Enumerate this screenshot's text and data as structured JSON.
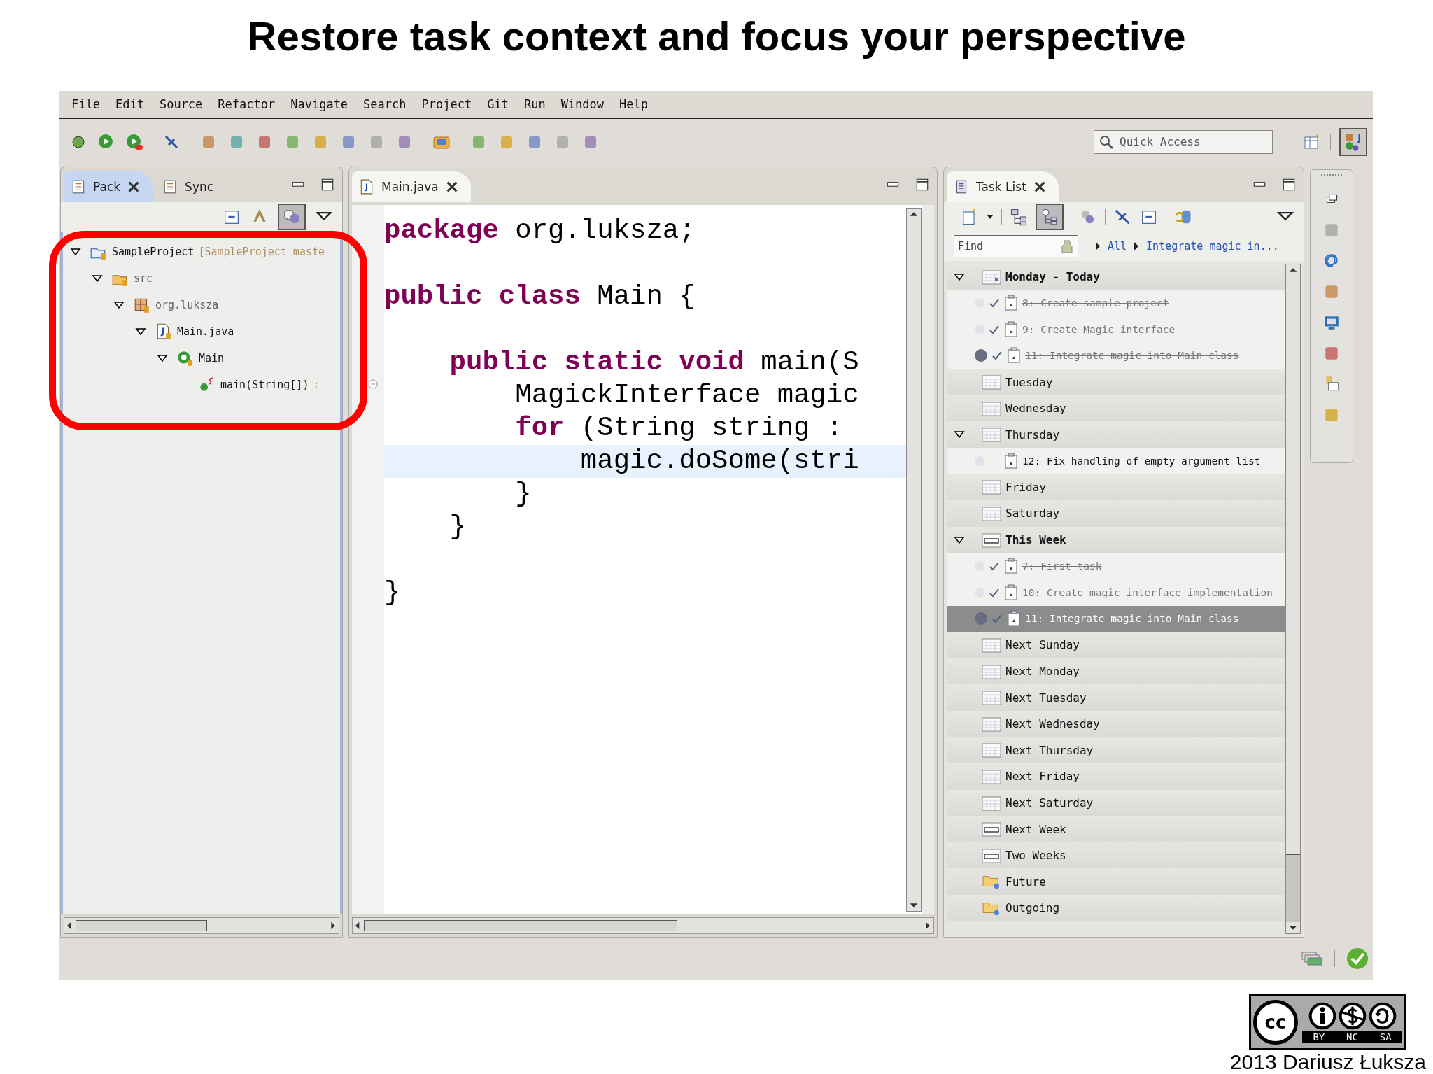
{
  "slide": {
    "title": "Restore task context and focus your perspective",
    "author": "2013 Dariusz Łuksza",
    "license_badge": {
      "mark": "cc",
      "labels": [
        "BY",
        "NC",
        "SA"
      ]
    }
  },
  "menu": [
    "File",
    "Edit",
    "Source",
    "Refactor",
    "Navigate",
    "Search",
    "Project",
    "Git",
    "Run",
    "Window",
    "Help"
  ],
  "quick_access": {
    "placeholder": "Quick Access"
  },
  "left_view": {
    "tabs": [
      {
        "label": "Pack",
        "selected": true
      },
      {
        "label": "Sync",
        "selected": false
      }
    ],
    "tree": [
      {
        "label": "SampleProject",
        "decoration": "[SampleProject maste",
        "kind": "project",
        "expanded": true,
        "children": [
          {
            "label": "src",
            "kind": "source-folder",
            "expanded": true,
            "children": [
              {
                "label": "org.luksza",
                "kind": "package",
                "expanded": true,
                "children": [
                  {
                    "label": "Main.java",
                    "kind": "file",
                    "expanded": true,
                    "children": [
                      {
                        "label": "Main",
                        "kind": "class",
                        "expanded": true,
                        "children": [
                          {
                            "label": "main(String[])",
                            "decoration": ":",
                            "kind": "method"
                          }
                        ]
                      }
                    ]
                  }
                ]
              }
            ]
          }
        ]
      }
    ]
  },
  "editor": {
    "tab": "Main.java",
    "lines": [
      {
        "kind": "code",
        "highlighted": false,
        "tokens": [
          {
            "text": "package",
            "keyword": true
          },
          {
            "text": " org.luksza;",
            "keyword": false
          }
        ]
      },
      {
        "kind": "blank"
      },
      {
        "kind": "code",
        "highlighted": false,
        "tokens": [
          {
            "text": "public class",
            "keyword": true
          },
          {
            "text": " Main {",
            "keyword": false
          }
        ]
      },
      {
        "kind": "blank"
      },
      {
        "kind": "code",
        "highlighted": false,
        "tokens": [
          {
            "text": "    public static void",
            "keyword": true
          },
          {
            "text": " main(S",
            "keyword": false
          }
        ]
      },
      {
        "kind": "code",
        "highlighted": false,
        "tokens": [
          {
            "text": "        MagickInterface magic",
            "keyword": false
          }
        ]
      },
      {
        "kind": "code",
        "highlighted": false,
        "tokens": [
          {
            "text": "        for",
            "keyword": true
          },
          {
            "text": " (String string :",
            "keyword": false
          }
        ]
      },
      {
        "kind": "code",
        "highlighted": true,
        "tokens": [
          {
            "text": "            magic.doSome(stri",
            "keyword": false
          }
        ]
      },
      {
        "kind": "code",
        "highlighted": false,
        "tokens": [
          {
            "text": "        }",
            "keyword": false
          }
        ]
      },
      {
        "kind": "code",
        "highlighted": false,
        "tokens": [
          {
            "text": "    }",
            "keyword": false
          }
        ]
      },
      {
        "kind": "blank"
      },
      {
        "kind": "code",
        "highlighted": false,
        "tokens": [
          {
            "text": "}",
            "keyword": false
          }
        ]
      }
    ]
  },
  "task_list": {
    "tab": "Task List",
    "find": {
      "placeholder": "Find"
    },
    "breadcrumbs": [
      "All",
      "Integrate magic in..."
    ],
    "groups": [
      {
        "label": "Monday - Today",
        "kind": "day-today",
        "bold": true,
        "expanded": true,
        "tasks": [
          {
            "label": "8: Create sample project",
            "completed": true,
            "active": false,
            "selected": false
          },
          {
            "label": "9: Create Magic interface",
            "completed": true,
            "active": false,
            "selected": false
          },
          {
            "label": "11: Integrate magic into Main class",
            "completed": true,
            "active": true,
            "selected": false
          }
        ]
      },
      {
        "label": "Tuesday",
        "kind": "day",
        "bold": false
      },
      {
        "label": "Wednesday",
        "kind": "day",
        "bold": false
      },
      {
        "label": "Thursday",
        "kind": "day",
        "bold": false,
        "expanded": true,
        "tasks": [
          {
            "label": "12: Fix handling of empty argument list",
            "completed": false,
            "active": false,
            "selected": false
          }
        ]
      },
      {
        "label": "Friday",
        "kind": "day",
        "bold": false
      },
      {
        "label": "Saturday",
        "kind": "day",
        "bold": false
      },
      {
        "label": "This Week",
        "kind": "week",
        "bold": true,
        "expanded": true,
        "tasks": [
          {
            "label": "7: First task",
            "completed": true,
            "active": false,
            "selected": false
          },
          {
            "label": "10: Create magic interface implementation",
            "completed": true,
            "active": false,
            "selected": false
          },
          {
            "label": "11: Integrate magic into Main class",
            "completed": true,
            "active": true,
            "selected": true
          }
        ]
      },
      {
        "label": "Next Sunday",
        "kind": "day",
        "bold": false
      },
      {
        "label": "Next Monday",
        "kind": "day",
        "bold": false
      },
      {
        "label": "Next Tuesday",
        "kind": "day",
        "bold": false
      },
      {
        "label": "Next Wednesday",
        "kind": "day",
        "bold": false
      },
      {
        "label": "Next Thursday",
        "kind": "day",
        "bold": false
      },
      {
        "label": "Next Friday",
        "kind": "day",
        "bold": false
      },
      {
        "label": "Next Saturday",
        "kind": "day",
        "bold": false
      },
      {
        "label": "Next Week",
        "kind": "week",
        "bold": false
      },
      {
        "label": "Two Weeks",
        "kind": "week",
        "bold": false
      },
      {
        "label": "Future",
        "kind": "folder",
        "bold": false
      },
      {
        "label": "Outgoing",
        "kind": "folder",
        "bold": false
      }
    ]
  }
}
